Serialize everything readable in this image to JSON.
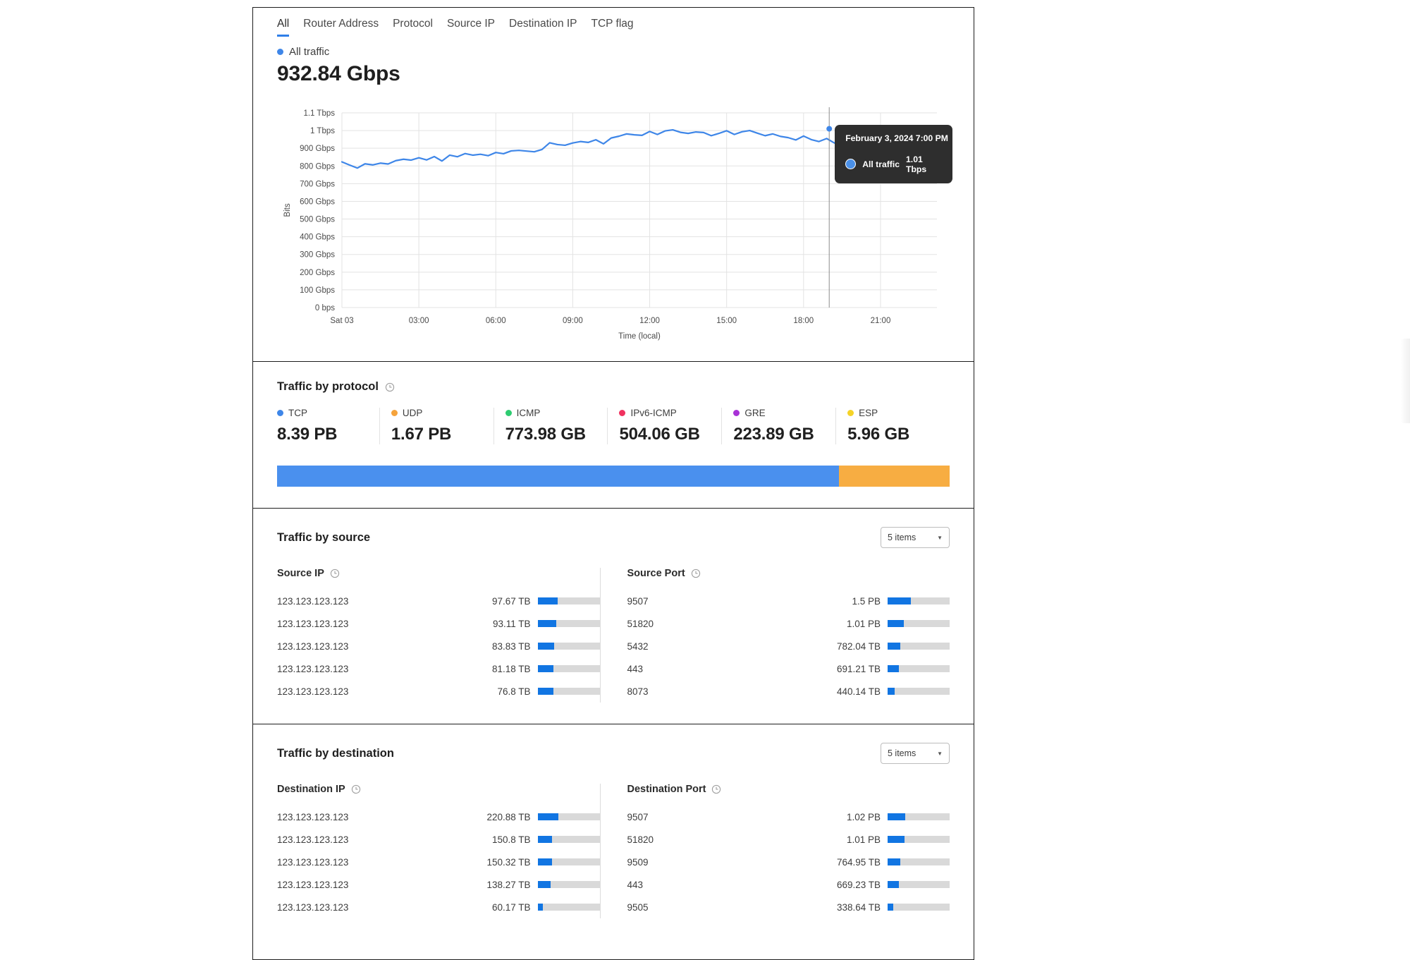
{
  "tabs": [
    {
      "label": "All",
      "active": true
    },
    {
      "label": "Router Address",
      "active": false
    },
    {
      "label": "Protocol",
      "active": false
    },
    {
      "label": "Source IP",
      "active": false
    },
    {
      "label": "Destination IP",
      "active": false
    },
    {
      "label": "TCP flag",
      "active": false
    }
  ],
  "overview": {
    "legend_label": "All traffic",
    "legend_color": "#3e86e8",
    "big_value": "932.84 Gbps"
  },
  "tooltip": {
    "title": "February 3, 2024 7:00 PM",
    "series_name": "All traffic",
    "series_value": "1.01 Tbps"
  },
  "chart_data": {
    "type": "line",
    "title": "All traffic",
    "xlabel": "Time (local)",
    "ylabel": "Bits",
    "legend": [
      "All traffic"
    ],
    "legend_position": "top-left",
    "grid": true,
    "series_color": "#3e86e8",
    "ylim": [
      0,
      1100
    ],
    "yunit": "Gbps",
    "ytick_labels": [
      "0 bps",
      "100 Gbps",
      "200 Gbps",
      "300 Gbps",
      "400 Gbps",
      "500 Gbps",
      "600 Gbps",
      "700 Gbps",
      "800 Gbps",
      "900 Gbps",
      "1 Tbps",
      "1.1 Tbps"
    ],
    "ytick_values": [
      0,
      100,
      200,
      300,
      400,
      500,
      600,
      700,
      800,
      900,
      1000,
      1100
    ],
    "xtick_labels": [
      "Sat 03",
      "03:00",
      "06:00",
      "09:00",
      "12:00",
      "15:00",
      "18:00",
      "21:00"
    ],
    "xtick_values": [
      0,
      3,
      6,
      9,
      12,
      15,
      18,
      21
    ],
    "x": [
      0,
      0.3,
      0.6,
      0.9,
      1.2,
      1.5,
      1.8,
      2.1,
      2.4,
      2.7,
      3.0,
      3.3,
      3.6,
      3.9,
      4.2,
      4.5,
      4.8,
      5.1,
      5.4,
      5.7,
      6.0,
      6.3,
      6.6,
      6.9,
      7.2,
      7.5,
      7.8,
      8.1,
      8.4,
      8.7,
      9.0,
      9.3,
      9.6,
      9.9,
      10.2,
      10.5,
      10.8,
      11.1,
      11.4,
      11.7,
      12.0,
      12.3,
      12.6,
      12.9,
      13.2,
      13.5,
      13.8,
      14.1,
      14.4,
      14.7,
      15.0,
      15.3,
      15.6,
      15.9,
      16.2,
      16.5,
      16.8,
      17.1,
      17.4,
      17.7,
      18.0,
      18.3,
      18.6,
      18.9,
      19.2,
      19.5,
      19.8
    ],
    "values": [
      823,
      805,
      788,
      812,
      806,
      816,
      811,
      830,
      838,
      833,
      846,
      834,
      853,
      828,
      861,
      852,
      870,
      861,
      866,
      858,
      876,
      869,
      885,
      888,
      884,
      880,
      893,
      931,
      921,
      917,
      930,
      938,
      933,
      948,
      925,
      958,
      968,
      981,
      976,
      973,
      995,
      978,
      998,
      1004,
      990,
      984,
      992,
      989,
      971,
      984,
      999,
      978,
      993,
      1000,
      985,
      971,
      981,
      967,
      960,
      947,
      969,
      949,
      938,
      955,
      930,
      912,
      1010
    ],
    "annotation_x": 19.0,
    "annotation_label": "February 3, 2024 7:00 PM",
    "annotation_value": "1.01 Tbps"
  },
  "protocol": {
    "title": "Traffic by protocol",
    "icon": "clock-icon",
    "items": [
      {
        "name": "TCP",
        "value": "8.39 PB",
        "color": "#3e86e8",
        "share": 77.8
      },
      {
        "name": "UDP",
        "value": "1.67 PB",
        "color": "#f5a33c",
        "share": 15.5
      },
      {
        "name": "ICMP",
        "value": "773.98 GB",
        "color": "#2ecc71",
        "share": 0.007
      },
      {
        "name": "IPv6-ICMP",
        "value": "504.06 GB",
        "color": "#f0325f",
        "share": 0.0046
      },
      {
        "name": "GRE",
        "value": "223.89 GB",
        "color": "#a832d6",
        "share": 0.002
      },
      {
        "name": "ESP",
        "value": "5.96 GB",
        "color": "#f5d327",
        "share": 5e-05
      }
    ],
    "stacked": [
      {
        "name": "TCP",
        "color": "#4a90ee",
        "pct": 83.5
      },
      {
        "name": "UDP",
        "color": "#f7ad42",
        "pct": 16.5
      }
    ]
  },
  "source": {
    "title": "Traffic by source",
    "items_select": "5 items",
    "caret": "▼",
    "columns": [
      {
        "header": "Source IP",
        "icon": "clock-icon",
        "rows": [
          {
            "key": "123.123.123.123",
            "value": "97.67 TB",
            "pct": 32
          },
          {
            "key": "123.123.123.123",
            "value": "93.11 TB",
            "pct": 30
          },
          {
            "key": "123.123.123.123",
            "value": "83.83 TB",
            "pct": 27
          },
          {
            "key": "123.123.123.123",
            "value": "81.18 TB",
            "pct": 26
          },
          {
            "key": "123.123.123.123",
            "value": "76.8 TB",
            "pct": 25
          }
        ]
      },
      {
        "header": "Source Port",
        "icon": "clock-icon",
        "rows": [
          {
            "key": "9507",
            "value": "1.5 PB",
            "pct": 37
          },
          {
            "key": "51820",
            "value": "1.01 PB",
            "pct": 26
          },
          {
            "key": "5432",
            "value": "782.04 TB",
            "pct": 20
          },
          {
            "key": "443",
            "value": "691.21 TB",
            "pct": 18
          },
          {
            "key": "8073",
            "value": "440.14 TB",
            "pct": 11
          }
        ]
      }
    ]
  },
  "destination": {
    "title": "Traffic by destination",
    "items_select": "5 items",
    "caret": "▼",
    "columns": [
      {
        "header": "Destination IP",
        "icon": "clock-icon",
        "rows": [
          {
            "key": "123.123.123.123",
            "value": "220.88 TB",
            "pct": 33
          },
          {
            "key": "123.123.123.123",
            "value": "150.8 TB",
            "pct": 23
          },
          {
            "key": "123.123.123.123",
            "value": "150.32 TB",
            "pct": 23
          },
          {
            "key": "123.123.123.123",
            "value": "138.27 TB",
            "pct": 21
          },
          {
            "key": "123.123.123.123",
            "value": "60.17 TB",
            "pct": 9
          }
        ]
      },
      {
        "header": "Destination Port",
        "icon": "clock-icon",
        "rows": [
          {
            "key": "9507",
            "value": "1.02 PB",
            "pct": 28
          },
          {
            "key": "51820",
            "value": "1.01 PB",
            "pct": 27
          },
          {
            "key": "9509",
            "value": "764.95 TB",
            "pct": 21
          },
          {
            "key": "443",
            "value": "669.23 TB",
            "pct": 18
          },
          {
            "key": "9505",
            "value": "338.64 TB",
            "pct": 9
          }
        ]
      }
    ]
  }
}
